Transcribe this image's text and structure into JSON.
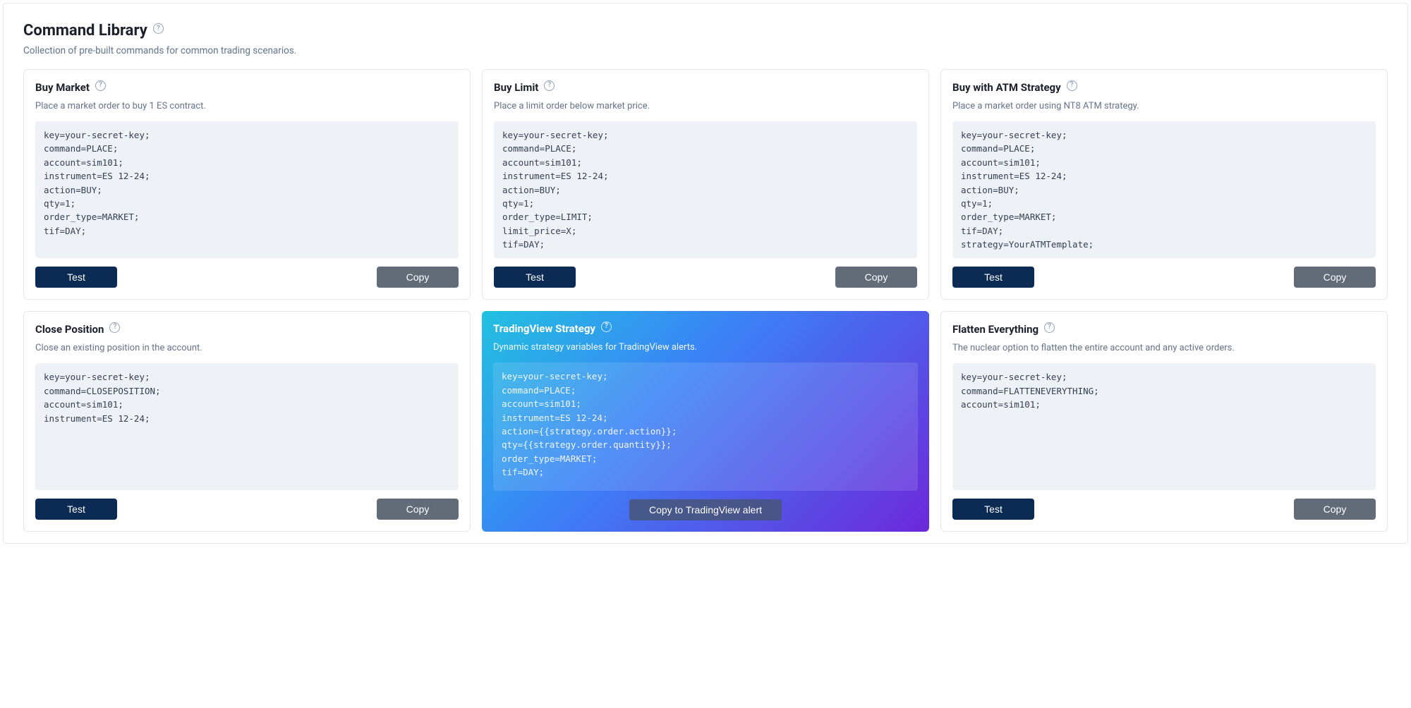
{
  "header": {
    "title": "Command Library",
    "subtitle": "Collection of pre-built commands for common trading scenarios."
  },
  "labels": {
    "test": "Test",
    "copy": "Copy",
    "copy_tradingview": "Copy to TradingView alert"
  },
  "cards": [
    {
      "title": "Buy Market",
      "desc": "Place a market order to buy 1 ES contract.",
      "code": "key=your-secret-key;\ncommand=PLACE;\naccount=sim101;\ninstrument=ES 12-24;\naction=BUY;\nqty=1;\norder_type=MARKET;\ntif=DAY;"
    },
    {
      "title": "Buy Limit",
      "desc": "Place a limit order below market price.",
      "code": "key=your-secret-key;\ncommand=PLACE;\naccount=sim101;\ninstrument=ES 12-24;\naction=BUY;\nqty=1;\norder_type=LIMIT;\nlimit_price=X;\ntif=DAY;"
    },
    {
      "title": "Buy with ATM Strategy",
      "desc": "Place a market order using NT8 ATM strategy.",
      "code": "key=your-secret-key;\ncommand=PLACE;\naccount=sim101;\ninstrument=ES 12-24;\naction=BUY;\nqty=1;\norder_type=MARKET;\ntif=DAY;\nstrategy=YourATMTemplate;"
    },
    {
      "title": "Close Position",
      "desc": "Close an existing position in the account.",
      "code": "key=your-secret-key;\ncommand=CLOSEPOSITION;\naccount=sim101;\ninstrument=ES 12-24;"
    },
    {
      "title": "TradingView Strategy",
      "desc": "Dynamic strategy variables for TradingView alerts.",
      "code": "key=your-secret-key;\ncommand=PLACE;\naccount=sim101;\ninstrument=ES 12-24;\naction={{strategy.order.action}};\nqty={{strategy.order.quantity}};\norder_type=MARKET;\ntif=DAY;"
    },
    {
      "title": "Flatten Everything",
      "desc": "The nuclear option to flatten the entire account and any active orders.",
      "code": "key=your-secret-key;\ncommand=FLATTENEVERYTHING;\naccount=sim101;"
    }
  ]
}
